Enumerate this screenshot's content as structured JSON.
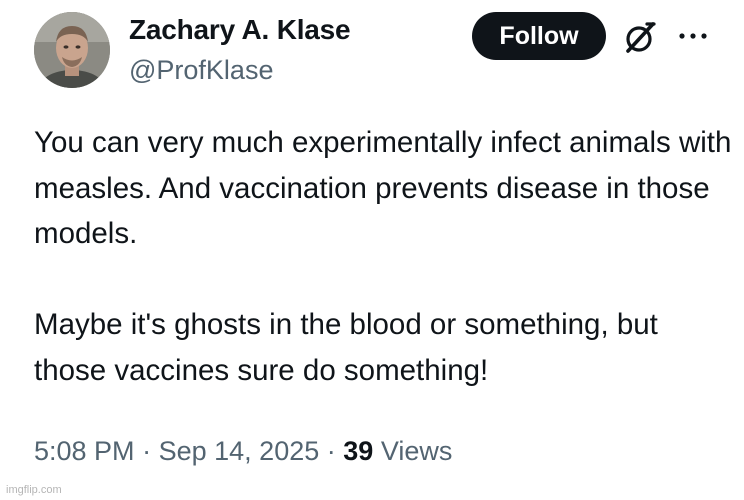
{
  "author": {
    "name": "Zachary A. Klase",
    "handle": "@ProfKlase",
    "avatar_icon": "person-avatar-icon"
  },
  "actions": {
    "follow_label": "Follow",
    "grok_icon": "grok-icon",
    "more_icon": "more-options-icon"
  },
  "tweet": {
    "paragraph1": "You can very much experimentally infect animals with measles. And vaccination prevents disease in those models.",
    "paragraph2": "Maybe it's ghosts in the blood or something, but those vaccines sure do something!"
  },
  "meta": {
    "time": "5:08 PM",
    "separator": "·",
    "date": "Sep 14, 2025",
    "views_count": "39",
    "views_label": "Views"
  },
  "watermark": "imgflip.com",
  "colors": {
    "text_primary": "#0f1419",
    "text_secondary": "#536471",
    "button_bg": "#0f1419",
    "button_text": "#ffffff"
  }
}
